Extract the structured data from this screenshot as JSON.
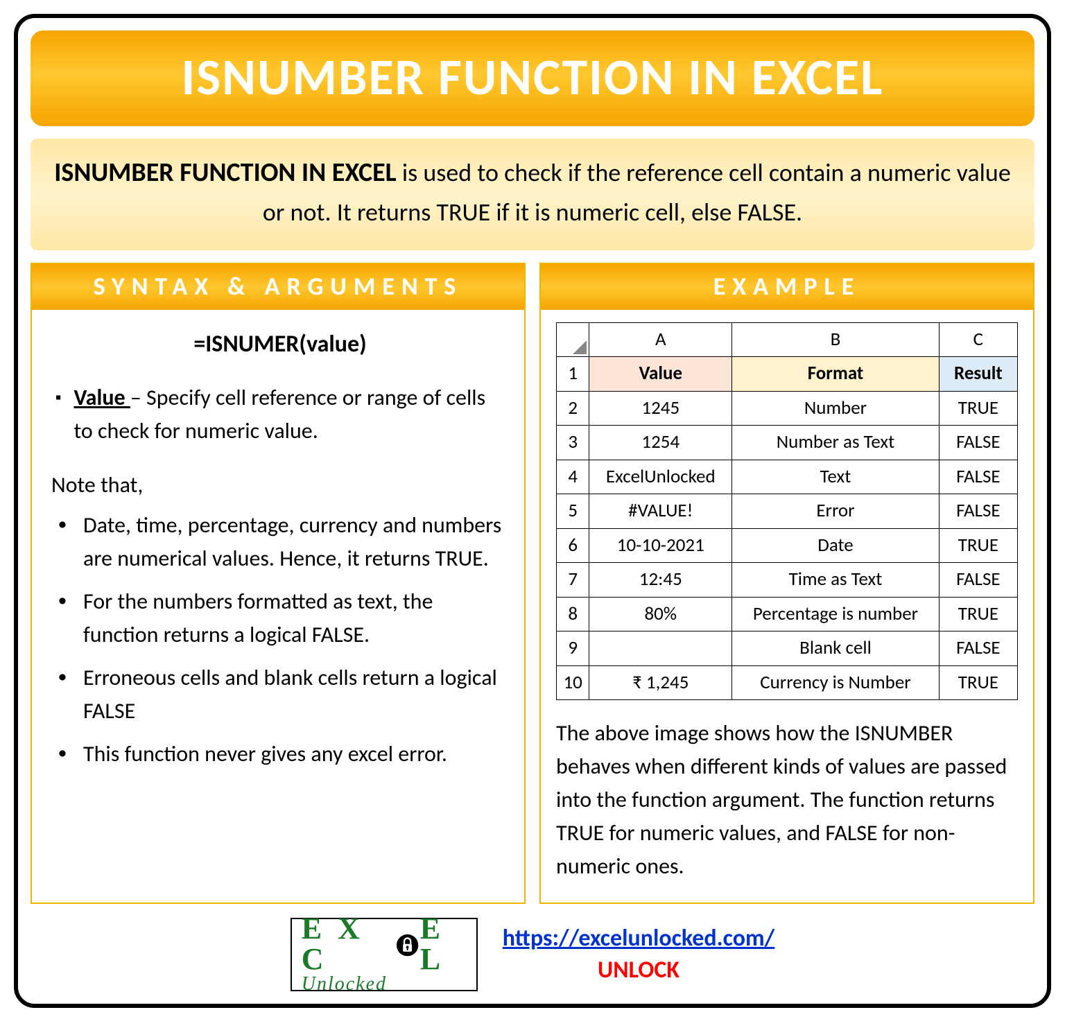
{
  "title": "ISNUMBER FUNCTION IN EXCEL",
  "intro": {
    "bold": "ISNUMBER FUNCTION IN EXCEL",
    "rest": " is used to check if the reference cell contain a numeric value or not. It returns TRUE if it is numeric cell, else FALSE."
  },
  "syntax": {
    "header": "SYNTAX & ARGUMENTS",
    "formula": "=ISNUMER(value)",
    "arg_name": "Value ",
    "arg_desc": "– Specify cell reference or range of cells to check for numeric value.",
    "note_heading": "Note that,",
    "notes": [
      "Date, time, percentage, currency and numbers are numerical values. Hence, it returns TRUE.",
      "For the numbers formatted as text, the function returns a logical FALSE.",
      "Erroneous cells and blank cells return a logical FALSE",
      "This function never gives any excel error."
    ]
  },
  "example": {
    "header": "EXAMPLE",
    "col_labels": [
      "A",
      "B",
      "C"
    ],
    "row_labels": [
      "1",
      "2",
      "3",
      "4",
      "5",
      "6",
      "7",
      "8",
      "9",
      "10"
    ],
    "headers": {
      "a": "Value",
      "b": "Format",
      "c": "Result"
    },
    "rows": [
      {
        "a": "1245",
        "b": "Number",
        "c": "TRUE"
      },
      {
        "a": "1254",
        "b": "Number as Text",
        "c": "FALSE"
      },
      {
        "a": "ExcelUnlocked",
        "b": "Text",
        "c": "FALSE"
      },
      {
        "a": "#VALUE!",
        "b": "Error",
        "c": "FALSE"
      },
      {
        "a": "10-10-2021",
        "b": "Date",
        "c": "TRUE"
      },
      {
        "a": "12:45",
        "b": "Time as Text",
        "c": "FALSE"
      },
      {
        "a": "80%",
        "b": "Percentage is number",
        "c": "TRUE"
      },
      {
        "a": "",
        "b": "Blank cell",
        "c": "FALSE"
      },
      {
        "a": "₹ 1,245",
        "b": "Currency is Number",
        "c": "TRUE"
      }
    ],
    "description": "The above image shows how the ISNUMBER behaves when different kinds of values are passed into the function argument. The function returns TRUE for numeric values, and FALSE for non-numeric ones."
  },
  "footer": {
    "logo_top": "E X C  E L",
    "logo_bottom": "Unlocked",
    "url": "https://excelunlocked.com/",
    "unlock": "UNLOCK"
  },
  "chart_data": {
    "type": "table",
    "title": "ISNUMBER Example",
    "columns": [
      "Value",
      "Format",
      "Result"
    ],
    "rows": [
      [
        "1245",
        "Number",
        "TRUE"
      ],
      [
        "1254",
        "Number as Text",
        "FALSE"
      ],
      [
        "ExcelUnlocked",
        "Text",
        "FALSE"
      ],
      [
        "#VALUE!",
        "Error",
        "FALSE"
      ],
      [
        "10-10-2021",
        "Date",
        "TRUE"
      ],
      [
        "12:45",
        "Time as Text",
        "FALSE"
      ],
      [
        "80%",
        "Percentage is number",
        "TRUE"
      ],
      [
        "",
        "Blank cell",
        "FALSE"
      ],
      [
        "₹ 1,245",
        "Currency is Number",
        "TRUE"
      ]
    ]
  }
}
